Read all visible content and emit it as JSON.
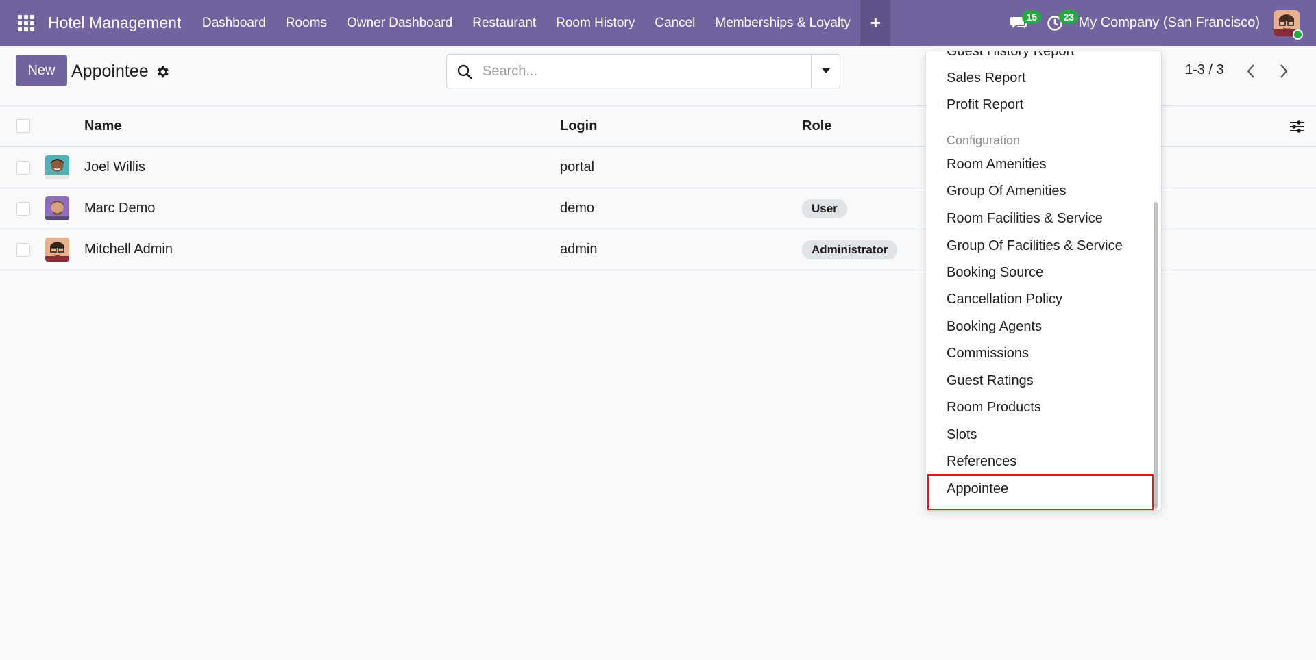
{
  "navbar": {
    "brand": "Hotel Management",
    "items": [
      "Dashboard",
      "Rooms",
      "Owner Dashboard",
      "Restaurant",
      "Room History",
      "Cancel",
      "Memberships & Loyalty"
    ],
    "plus_label": "+",
    "messages_count": "15",
    "activities_count": "23",
    "company": "My Company (San Francisco)"
  },
  "control_panel": {
    "new_label": "New",
    "title": "Appointee",
    "search_placeholder": "Search...",
    "pager": "1-3 / 3"
  },
  "list": {
    "headers": {
      "name": "Name",
      "login": "Login",
      "role": "Role"
    },
    "rows": [
      {
        "name": "Joel Willis",
        "login": "portal",
        "role": ""
      },
      {
        "name": "Marc Demo",
        "login": "demo",
        "role": "User"
      },
      {
        "name": "Mitchell Admin",
        "login": "admin",
        "role": "Administrator"
      }
    ]
  },
  "dropdown": {
    "partial_item": "Guest History Report",
    "items_top": [
      "Sales Report",
      "Profit Report"
    ],
    "section_header": "Configuration",
    "config_items": [
      "Room Amenities",
      "Group Of Amenities",
      "Room Facilities & Service",
      "Group Of Facilities & Service",
      "Booking Source",
      "Cancellation Policy",
      "Booking Agents",
      "Commissions",
      "Guest Ratings",
      "Room Products",
      "Slots",
      "References",
      "Appointee"
    ]
  },
  "colors": {
    "navbar": "#71639e",
    "primary_button": "#71639e",
    "badge": "#28a745",
    "highlight": "#e0191b"
  }
}
